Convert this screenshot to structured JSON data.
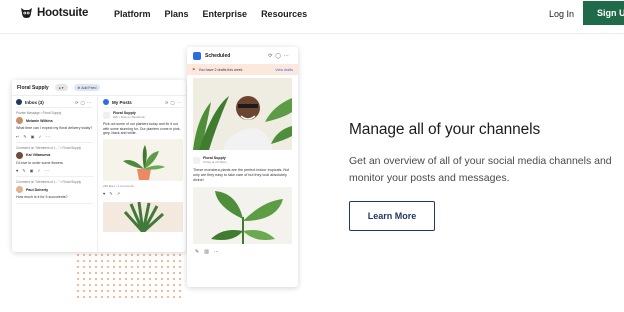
{
  "nav": {
    "logo_text": "Hootsuite",
    "links": [
      "Platform",
      "Plans",
      "Enterprise",
      "Resources"
    ],
    "login": "Log In",
    "signup": "Sign Up"
  },
  "illustration": {
    "back_card": {
      "org_name": "Floral Supply",
      "add_feed": "Add Feed",
      "inbox": {
        "title": "Inbox (3)",
        "messages": [
          {
            "context": "Private Message • Floral Supply",
            "name": "Melanie Wilkins",
            "text": "What time can I expect my floral delivery today?"
          },
          {
            "context": "Comment on \"Members of L...\" • Floral Supply",
            "name": "Kai Villanueva",
            "text": "I'd love to order some flowers"
          },
          {
            "context": "Comment on \"Members of L...\" • Floral Supply",
            "name": "Paul Doherty",
            "text": "How much is it for 5 succulents?"
          }
        ]
      },
      "posts": {
        "title": "My Posts",
        "author": "Floral Supply",
        "meta": "20h • Now on Facebook",
        "text": "Pick out some of our planters today and fix it out with some stunning fur. Our planters come in pink, grey, black and white.",
        "stats": "248 likes  •  4 comments"
      }
    },
    "front_card": {
      "title": "Scheduled",
      "drafts_notice": "You have 2 drafts this week",
      "drafts_link": "View drafts",
      "post": {
        "author": "Floral Supply",
        "meta": "Today at 12:30pm",
        "text": "These monstera plants are the perfect indoor tropicals. Not only are they easy to take care of but they look absolutely divine!"
      }
    },
    "colors": {
      "accent_green": "#1f6b49",
      "navy": "#1f3864",
      "drafts_bg": "#fde8de",
      "dots": "#f2a97a"
    }
  },
  "content": {
    "headline": "Manage all of your channels",
    "body": "Get an overview of all of your social media channels and monitor your posts and messages.",
    "cta": "Learn More"
  }
}
